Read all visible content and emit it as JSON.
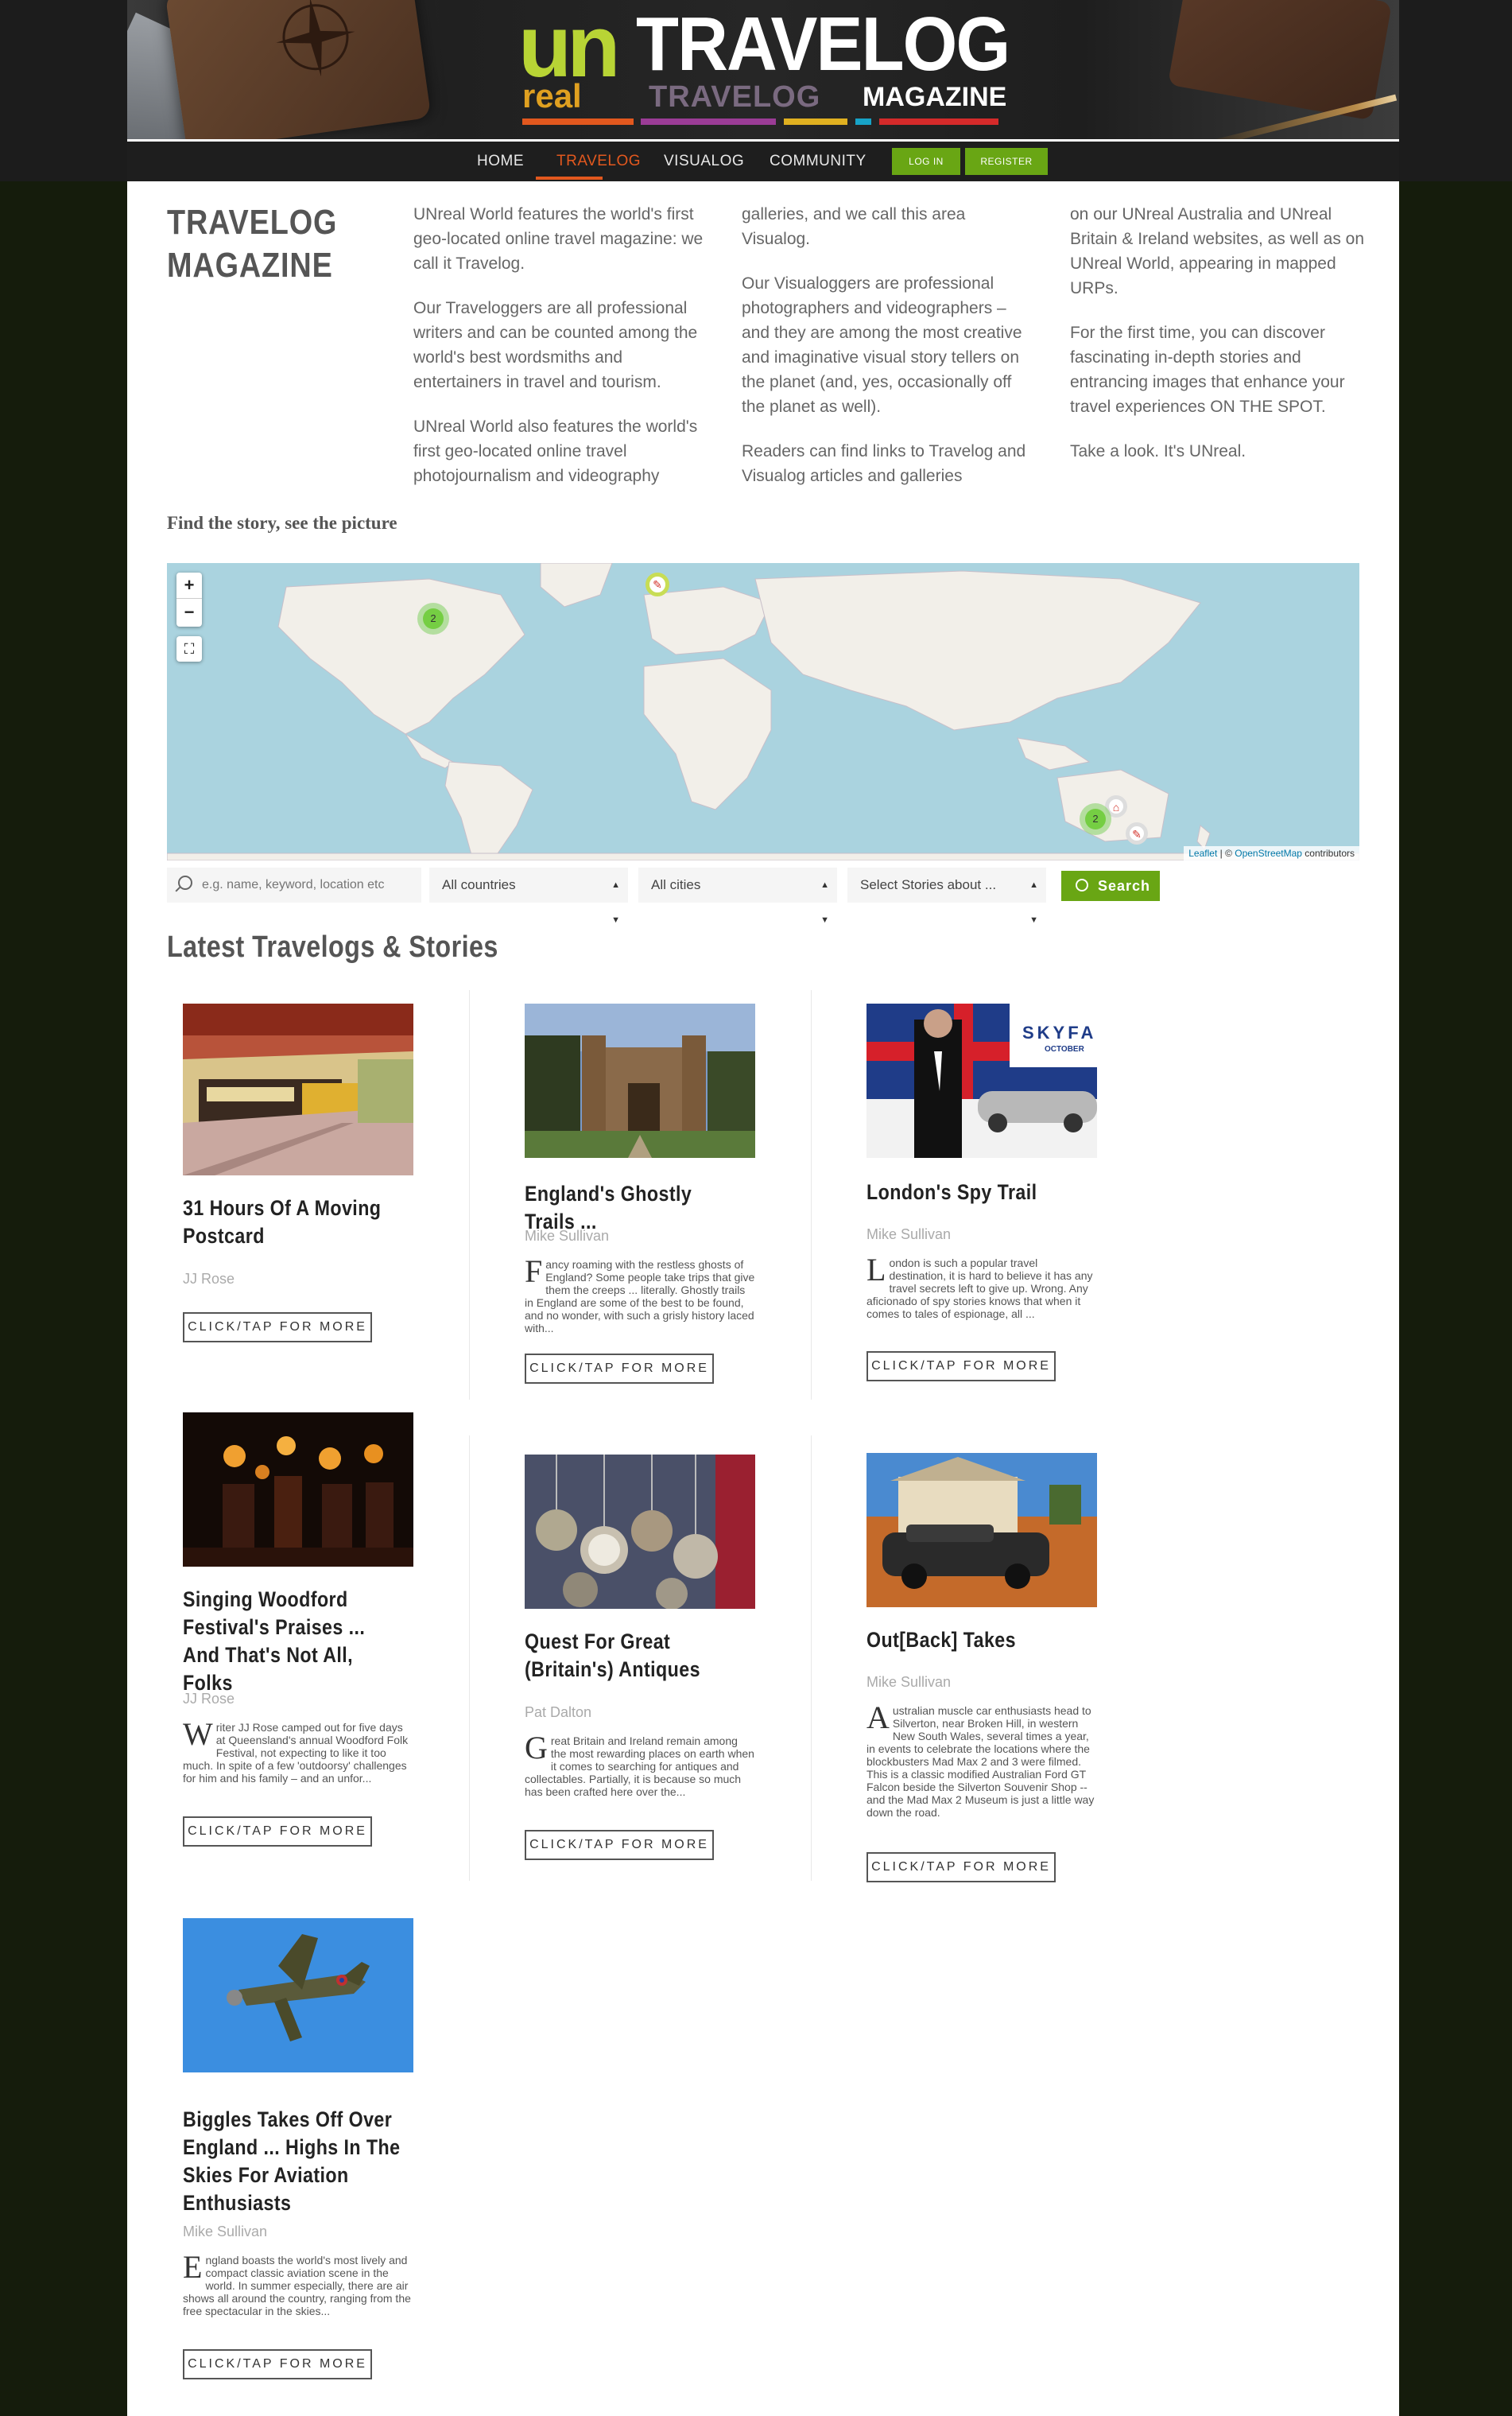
{
  "brand": {
    "logo_un": "un",
    "logo_real": "real",
    "logo_travelog": "TRAVELOG",
    "logo_travelog_ghost": "TRAVELOG",
    "logo_magazine": "MAGAZINE",
    "bar_colors": [
      "#e2581e",
      "#9b3c96",
      "#e0b020",
      "#17a3c7",
      "#d52a2a"
    ]
  },
  "nav": {
    "items": [
      "HOME",
      "TRAVELOG",
      "VISUALOG",
      "COMMUNITY"
    ],
    "active": "TRAVELOG",
    "login": "LOG IN",
    "register": "REGISTER"
  },
  "intro": {
    "title_line1": "TRAVELOG",
    "title_line2": "MAGAZINE",
    "col1": [
      "UNreal World features the world's first geo-located online travel magazine: we call it Travelog.",
      "Our Traveloggers are all professional writers and can be counted among the world's best wordsmiths and entertainers in travel and tourism.",
      "UNreal World also features the world's first geo-located online travel photojournalism and videography"
    ],
    "col2": [
      "galleries, and we call this area Visualog.",
      "Our Visualoggers are professional photographers and videographers – and they are among the most creative and imaginative visual story tellers on the planet (and, yes, occasionally off the planet as well).",
      "Readers can find links to Travelog and Visualog articles and galleries"
    ],
    "col3": [
      "on our UNreal Australia and UNreal Britain & Ireland websites, as well as on UNreal World, appearing in mapped URPs.",
      "For the first time, you can discover fascinating in-depth stories and entrancing images that enhance your travel experiences ON THE SPOT.",
      "Take a look. It's UNreal."
    ],
    "find_story": "Find the story, see the picture"
  },
  "map": {
    "zoom_in": "+",
    "zoom_out": "−",
    "fullscreen": "⛶",
    "cluster_na": "2",
    "cluster_au": "2",
    "attribution_leaflet": "Leaflet",
    "attribution_sep": " | © ",
    "attribution_osm": "OpenStreetMap",
    "attribution_tail": " contributors"
  },
  "search": {
    "placeholder": "e.g. name, keyword, location etc",
    "countries": "All countries",
    "cities": "All cities",
    "stories": "Select Stories about ...",
    "button": "Search"
  },
  "latest_title": "Latest Travelogs & Stories",
  "cards": [
    {
      "title": "31 Hours Of A Moving Postcard",
      "author": "JJ Rose",
      "dropcap": "",
      "excerpt": "",
      "button": "CLICK/TAP FOR MORE"
    },
    {
      "title": "England's Ghostly Trails ...",
      "author": "Mike Sullivan",
      "dropcap": "F",
      "excerpt": "ancy roaming with the restless ghosts of England? Some people take trips that give them the creeps ... literally. Ghostly trails in England are some of the best to be found, and no wonder, with such a grisly history laced with...",
      "button": "CLICK/TAP FOR MORE"
    },
    {
      "title": "London's Spy Trail",
      "author": "Mike Sullivan",
      "dropcap": "L",
      "excerpt": "ondon is such a popular travel destination, it is hard to believe it has any travel secrets left to give up. Wrong. Any aficionado of spy stories knows that when it comes to tales of espionage, all ...",
      "button": "CLICK/TAP FOR MORE",
      "poster_text": "SKYFAL",
      "poster_sub": "OCTOBER"
    },
    {
      "title": "Singing Woodford Festival's Praises ... And That's Not All, Folks",
      "author": "JJ Rose",
      "dropcap": "W",
      "excerpt": "riter JJ Rose camped out for five days at Queensland's annual Woodford Folk Festival, not expecting to like it too much. In spite of a few 'outdoorsy' challenges for him and his family – and an unfor...",
      "button": "CLICK/TAP FOR MORE"
    },
    {
      "title": "Quest For Great (Britain's) Antiques",
      "author": "Pat Dalton",
      "dropcap": "G",
      "excerpt": "reat Britain and Ireland remain among the most rewarding places on earth when it comes to searching for antiques and collectables. Partially, it is because so much has been crafted here over the...",
      "button": "CLICK/TAP FOR MORE"
    },
    {
      "title": "Out[Back] Takes",
      "author": "Mike Sullivan",
      "dropcap": "A",
      "excerpt": "ustralian muscle car enthusiasts head to Silverton, near Broken Hill, in western New South Wales, several times a year, in events to celebrate the locations where the blockbusters Mad Max 2 and 3 were filmed. This is a classic modified Australian Ford GT Falcon beside the Silverton Souvenir Shop -- and the Mad Max 2 Museum is just a little way down the road.",
      "button": "CLICK/TAP FOR MORE"
    },
    {
      "title": "Biggles Takes Off Over England ... Highs In The Skies For Aviation Enthusiasts",
      "author": "Mike Sullivan",
      "dropcap": "E",
      "excerpt": "ngland boasts the world's most lively and compact classic aviation scene in the world. In summer especially, there are air shows all around the country, ranging from the free spectacular in the skies...",
      "button": "CLICK/TAP FOR MORE"
    }
  ]
}
